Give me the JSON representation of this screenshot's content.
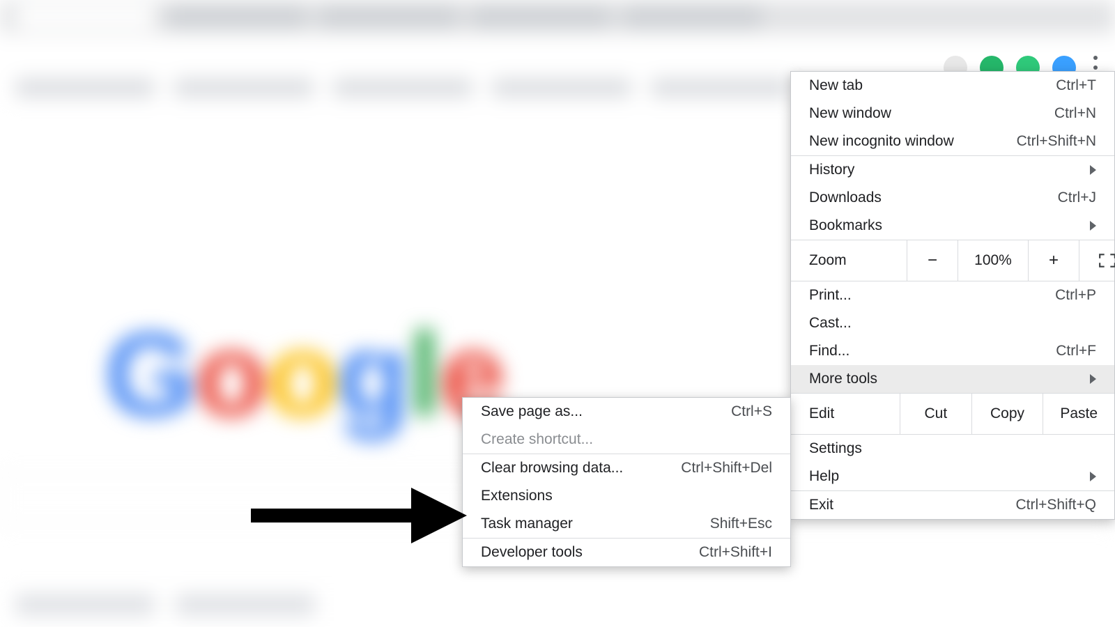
{
  "browser": {
    "zoom_value": "100%",
    "logo_letters": [
      "G",
      "o",
      "o",
      "g",
      "l",
      "e"
    ]
  },
  "main_menu": {
    "new_tab": {
      "label": "New tab",
      "shortcut": "Ctrl+T"
    },
    "new_window": {
      "label": "New window",
      "shortcut": "Ctrl+N"
    },
    "new_incognito": {
      "label": "New incognito window",
      "shortcut": "Ctrl+Shift+N"
    },
    "history": {
      "label": "History"
    },
    "downloads": {
      "label": "Downloads",
      "shortcut": "Ctrl+J"
    },
    "bookmarks": {
      "label": "Bookmarks"
    },
    "zoom_label": "Zoom",
    "print": {
      "label": "Print...",
      "shortcut": "Ctrl+P"
    },
    "cast": {
      "label": "Cast..."
    },
    "find": {
      "label": "Find...",
      "shortcut": "Ctrl+F"
    },
    "more_tools": {
      "label": "More tools"
    },
    "edit_label": "Edit",
    "cut": "Cut",
    "copy": "Copy",
    "paste": "Paste",
    "settings": {
      "label": "Settings"
    },
    "help": {
      "label": "Help"
    },
    "exit": {
      "label": "Exit",
      "shortcut": "Ctrl+Shift+Q"
    }
  },
  "more_tools_menu": {
    "save_page": {
      "label": "Save page as...",
      "shortcut": "Ctrl+S"
    },
    "create_shortcut": {
      "label": "Create shortcut..."
    },
    "clear_data": {
      "label": "Clear browsing data...",
      "shortcut": "Ctrl+Shift+Del"
    },
    "extensions": {
      "label": "Extensions"
    },
    "task_manager": {
      "label": "Task manager",
      "shortcut": "Shift+Esc"
    },
    "dev_tools": {
      "label": "Developer tools",
      "shortcut": "Ctrl+Shift+I"
    }
  },
  "avatars": {
    "a1": "#e8e8e8",
    "a2": "#25b76a",
    "a3": "#2fc97a",
    "a4": "#3aa0ff"
  }
}
